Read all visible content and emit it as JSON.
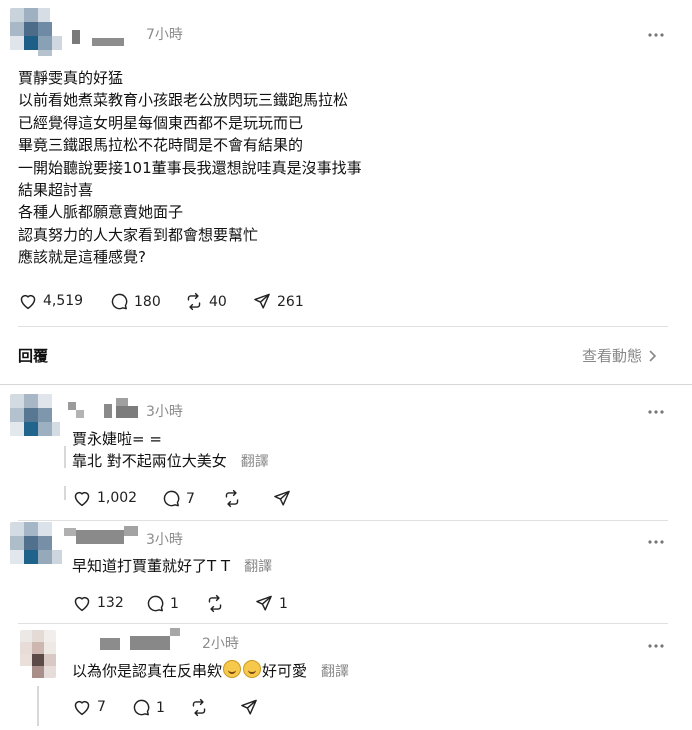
{
  "post": {
    "time": "7小時",
    "lines": [
      "賈靜雯真的好猛",
      "以前看她煮菜教育小孩跟老公放閃玩三鐵跑馬拉松",
      "已經覺得這女明星每個東西都不是玩玩而已",
      "畢竟三鐵跟馬拉松不花時間是不會有結果的",
      "一開始聽說要接101董事長我還想說哇真是沒事找事",
      "結果超討喜",
      "各種人脈都願意賣她面子",
      "認真努力的人大家看到都會想要幫忙",
      "應該就是這種感覺?"
    ],
    "likes": "4,519",
    "comments": "180",
    "reposts": "40",
    "shares": "261"
  },
  "replies_header": {
    "label": "回覆",
    "activity_link": "查看動態"
  },
  "replies": [
    {
      "time": "3小時",
      "lines": [
        "賈永婕啦= =",
        "靠北 對不起兩位大美女"
      ],
      "translate": "翻譯",
      "likes": "1,002",
      "comments": "7"
    },
    {
      "time": "3小時",
      "text": "早知道打賈董就好了T T",
      "translate": "翻譯",
      "likes": "132",
      "comments": "1",
      "shares": "1"
    },
    {
      "time": "2小時",
      "text_before": "以為你是認真在反串欸",
      "text_after": "好可愛",
      "translate": "翻譯",
      "likes": "7",
      "comments": "1"
    }
  ],
  "icons": {
    "heart": "heart-icon",
    "comment": "comment-bubble-icon",
    "repost": "repost-icon",
    "share": "share-icon",
    "more": "more-icon",
    "chevron": "chevron-right-icon",
    "emoji": "rolling-laughing-emoji"
  }
}
